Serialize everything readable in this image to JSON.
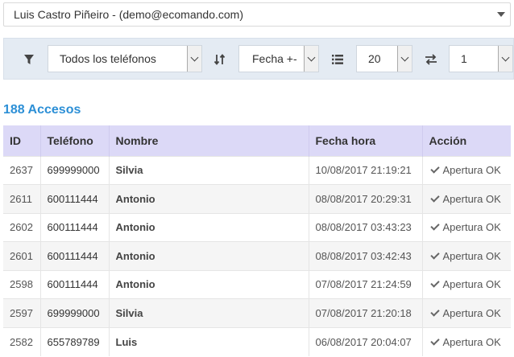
{
  "user_selector": {
    "value": "Luis Castro Piñeiro - (demo@ecomando.com)"
  },
  "toolbar": {
    "filter_icon": "filter-icon",
    "phone_filter": {
      "value": "Todos los teléfonos"
    },
    "sort_icon": "sort-icon",
    "sort_select": {
      "value": "Fecha +-"
    },
    "list_icon": "list-icon",
    "page_size": {
      "value": "20"
    },
    "page_icon": "swap-icon",
    "page_select": {
      "value": "1"
    }
  },
  "summary": {
    "title": "188 Accesos"
  },
  "table": {
    "columns": [
      "ID",
      "Teléfono",
      "Nombre",
      "Fecha hora",
      "Acción"
    ],
    "rows": [
      {
        "id": "2637",
        "phone": "699999000",
        "name": "Silvia",
        "datetime": "10/08/2017 21:19:21",
        "action": "Apertura OK"
      },
      {
        "id": "2611",
        "phone": "600111444",
        "name": "Antonio",
        "datetime": "08/08/2017 20:29:31",
        "action": "Apertura OK"
      },
      {
        "id": "2602",
        "phone": "600111444",
        "name": "Antonio",
        "datetime": "08/08/2017 03:43:23",
        "action": "Apertura OK"
      },
      {
        "id": "2601",
        "phone": "600111444",
        "name": "Antonio",
        "datetime": "08/08/2017 03:42:43",
        "action": "Apertura OK"
      },
      {
        "id": "2598",
        "phone": "600111444",
        "name": "Antonio",
        "datetime": "07/08/2017 21:24:59",
        "action": "Apertura OK"
      },
      {
        "id": "2597",
        "phone": "699999000",
        "name": "Silvia",
        "datetime": "07/08/2017 21:20:18",
        "action": "Apertura OK"
      },
      {
        "id": "2582",
        "phone": "655789789",
        "name": "Luis",
        "datetime": "06/08/2017 20:04:07",
        "action": "Apertura OK"
      }
    ]
  }
}
